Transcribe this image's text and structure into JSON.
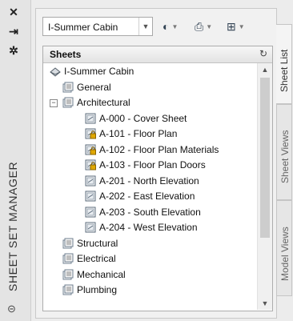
{
  "palette": {
    "title": "SHEET SET MANAGER",
    "strip_icons": [
      "close-icon",
      "pin-icon",
      "properties-icon"
    ],
    "bottom_icon": "palette-menu-icon"
  },
  "toolbar": {
    "sheet_set": "I-Summer Cabin",
    "buttons": [
      "publish-icon",
      "plot-icon",
      "model-views-icon"
    ]
  },
  "tree": {
    "header": "Sheets",
    "items": [
      {
        "label": "I-Summer Cabin",
        "level": 0,
        "type": "sheetset",
        "expand": "none"
      },
      {
        "label": "General",
        "level": 1,
        "type": "subset",
        "expand": "none"
      },
      {
        "label": "Architectural",
        "level": 1,
        "type": "subset",
        "expand": "minus"
      },
      {
        "label": "A-000 - Cover Sheet",
        "level": 2,
        "type": "sheet",
        "locked": false
      },
      {
        "label": "A-101 - Floor Plan",
        "level": 2,
        "type": "sheet",
        "locked": true
      },
      {
        "label": "A-102 - Floor Plan Materials",
        "level": 2,
        "type": "sheet",
        "locked": true
      },
      {
        "label": "A-103 - Floor Plan Doors",
        "level": 2,
        "type": "sheet",
        "locked": true
      },
      {
        "label": "A-201 - North Elevation",
        "level": 2,
        "type": "sheet",
        "locked": false
      },
      {
        "label": "A-202 - East Elevation",
        "level": 2,
        "type": "sheet",
        "locked": false
      },
      {
        "label": "A-203 - South Elevation",
        "level": 2,
        "type": "sheet",
        "locked": false
      },
      {
        "label": "A-204 - West Elevation",
        "level": 2,
        "type": "sheet",
        "locked": false
      },
      {
        "label": "Structural",
        "level": 1,
        "type": "subset",
        "expand": "none"
      },
      {
        "label": "Electrical",
        "level": 1,
        "type": "subset",
        "expand": "none"
      },
      {
        "label": "Mechanical",
        "level": 1,
        "type": "subset",
        "expand": "none"
      },
      {
        "label": "Plumbing",
        "level": 1,
        "type": "subset",
        "expand": "none"
      }
    ]
  },
  "tabs": [
    {
      "label": "Sheet List",
      "active": true
    },
    {
      "label": "Sheet Views",
      "active": false
    },
    {
      "label": "Model Views",
      "active": false
    }
  ],
  "colors": {
    "lock": "#e0a800",
    "sheet_icon": "#5a6a7a",
    "folder_icon": "#6f7f8f"
  }
}
